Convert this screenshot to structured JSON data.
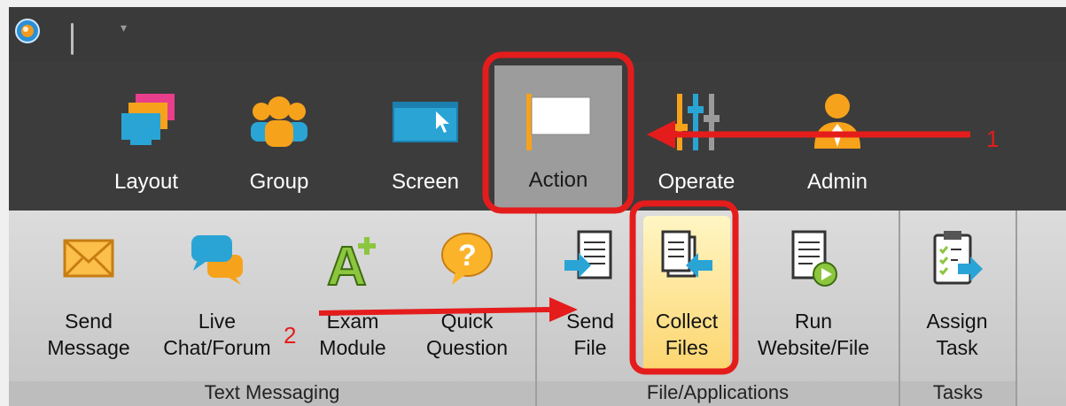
{
  "tabs": [
    {
      "label": "Layout",
      "icon": "layout-icon"
    },
    {
      "label": "Group",
      "icon": "group-icon"
    },
    {
      "label": "Screen",
      "icon": "screen-icon"
    },
    {
      "label": "Action",
      "icon": "flag-icon",
      "active": true
    },
    {
      "label": "Operate",
      "icon": "sliders-icon"
    },
    {
      "label": "Admin",
      "icon": "admin-icon"
    }
  ],
  "ribbon": {
    "groups": [
      {
        "title": "Text Messaging",
        "buttons": [
          {
            "label": "Send\nMessage",
            "icon": "envelope-icon"
          },
          {
            "label": "Live\nChat/Forum",
            "icon": "chat-icon"
          },
          {
            "label": "Exam\nModule",
            "icon": "exam-icon"
          },
          {
            "label": "Quick\nQuestion",
            "icon": "question-icon"
          }
        ]
      },
      {
        "title": "File/Applications",
        "buttons": [
          {
            "label": "Send\nFile",
            "icon": "send-file-icon"
          },
          {
            "label": "Collect\nFiles",
            "icon": "collect-files-icon",
            "highlighted": true
          },
          {
            "label": "Run\nWebsite/File",
            "icon": "run-file-icon"
          }
        ]
      },
      {
        "title": "Tasks",
        "buttons": [
          {
            "label": "Assign\nTask",
            "icon": "assign-task-icon"
          }
        ]
      }
    ]
  },
  "annotations": {
    "step1": "1",
    "step2": "2",
    "color": "#e51c1c"
  },
  "colors": {
    "ribbon_highlight": "#fcd56f",
    "active_tab": "#9c9c9c",
    "window": "#3c3c3c"
  }
}
